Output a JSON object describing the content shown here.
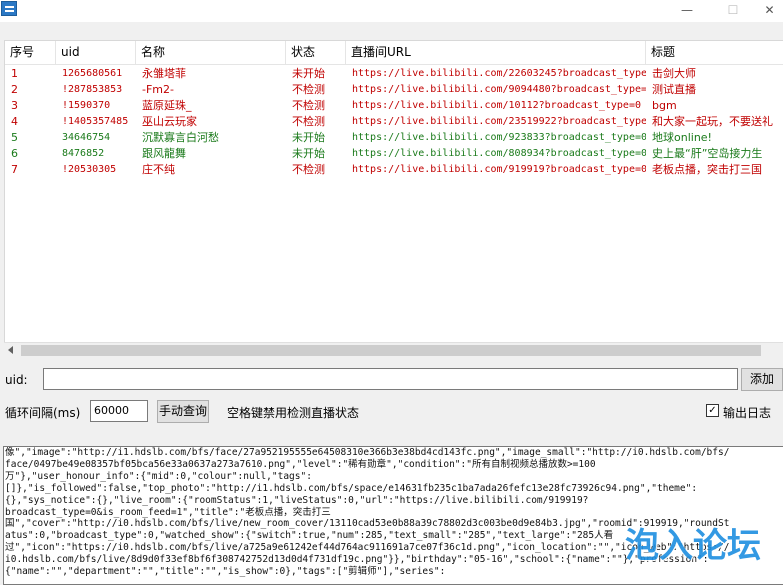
{
  "window": {
    "minimize": "—",
    "maximize": "☐",
    "close": "✕"
  },
  "table": {
    "headers": [
      "序号",
      "uid",
      "名称",
      "状态",
      "直播间URL",
      "标题"
    ],
    "rows": [
      {
        "no": "1",
        "uid": "1265680561",
        "name": "永雏塔菲",
        "status": "未开始",
        "url": "https://live.bilibili.com/22603245?broadcast_type=0",
        "title": "击剑大师",
        "color": "#c00000"
      },
      {
        "no": "2",
        "uid": "!287853853",
        "name": "-Fm2-",
        "status": "不检测",
        "url": "https://live.bilibili.com/9094480?broadcast_type=0",
        "title": "测试直播",
        "color": "#c00000"
      },
      {
        "no": "3",
        "uid": "!1590370",
        "name": "蓝原延珠_",
        "status": "不检测",
        "url": "https://live.bilibili.com/10112?broadcast_type=0",
        "title": "bgm",
        "color": "#c00000"
      },
      {
        "no": "4",
        "uid": "!1405357485",
        "name": "巫山云玩家",
        "status": "不检测",
        "url": "https://live.bilibili.com/23519922?broadcast_type=0",
        "title": "和大家一起玩，不要送礼",
        "color": "#c00000"
      },
      {
        "no": "5",
        "uid": "34646754",
        "name": "沉默寡言白河愁",
        "status": "未开始",
        "url": "https://live.bilibili.com/923833?broadcast_type=0",
        "title": "地球online!",
        "color": "#1a7a1a"
      },
      {
        "no": "6",
        "uid": "8476852",
        "name": "跟风龍舞",
        "status": "未开始",
        "url": "https://live.bilibili.com/808934?broadcast_type=0",
        "title": "史上最“肝”空岛接力生",
        "color": "#1a7a1a"
      },
      {
        "no": "7",
        "uid": "!20530305",
        "name": "庄不纯",
        "status": "不检测",
        "url": "https://live.bilibili.com/919919?broadcast_type=0",
        "title": "老板点播，突击打三国",
        "color": "#c00000"
      }
    ]
  },
  "form": {
    "uid_label": "uid:",
    "add_button": "添加",
    "interval_label": "循环间隔(ms)",
    "interval_value": "60000",
    "query_button": "手动查询",
    "space_hint": "空格键禁用检测直播状态",
    "log_checkbox_label": "输出日志",
    "log_checkbox_checked": true
  },
  "log": {
    "lines": [
      "像\",\"image\":\"http://i1.hdslb.com/bfs/face/27a952195555e64508310e366b3e38bd4cd143fc.png\",\"image_small\":\"http://i0.hdslb.com/bfs/",
      "face/0497be49e08357bf05bca56e33a0637a273a7610.png\",\"level\":\"稀有勋章\",\"condition\":\"所有自制视频总播放数>=100",
      "万\"},\"user_honour_info\":{\"mid\":0,\"colour\":null,\"tags\":",
      "[]},\"is_followed\":false,\"top_photo\":\"http://i1.hdslb.com/bfs/space/e14631fb235c1ba7ada26fefc13e28fc73926c94.png\",\"theme\":",
      "{},\"sys_notice\":{},\"live_room\":{\"roomStatus\":1,\"liveStatus\":0,\"url\":\"https://live.bilibili.com/919919?",
      "broadcast_type=0&is_room_feed=1\",\"title\":\"老板点播，突击打三",
      "国\",\"cover\":\"http://i0.hdslb.com/bfs/live/new_room_cover/13110cad53e0b88a39c78802d3c003be0d9e84b3.jpg\",\"roomid\":919919,\"roundSt",
      "atus\":0,\"broadcast_type\":0,\"watched_show\":{\"switch\":true,\"num\":285,\"text_small\":\"285\",\"text_large\":\"285人看",
      "过\",\"icon\":\"https://i0.hdslb.com/bfs/live/a725a9e61242ef44d764ac911691a7ce07f36c1d.png\",\"icon_location\":\"\",\"icon_web\":\"https://",
      "i0.hdslb.com/bfs/live/8d9d0f33ef8bf6f308742752d13d0d4f731df19c.png\"}},\"birthday\":\"05-16\",\"school\":{\"name\":\"\"},\"profession\":",
      "{\"name\":\"\",\"department\":\"\",\"title\":\"\",\"is_show\":0},\"tags\":[\"剪辑师\"],\"series\":"
    ]
  },
  "watermark": "泡入论坛"
}
